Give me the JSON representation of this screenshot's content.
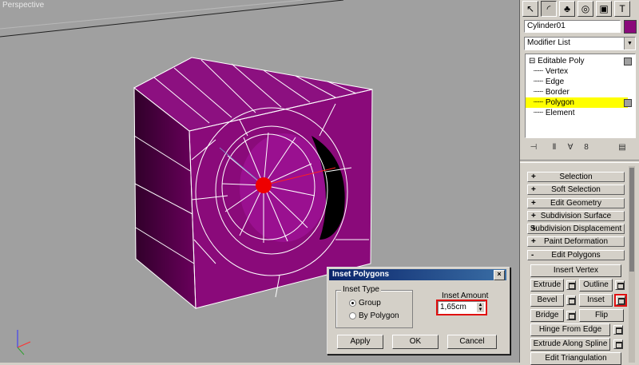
{
  "viewport": {
    "label": "Perspective"
  },
  "panel": {
    "tabs": [
      "pointer-icon",
      "modify-icon",
      "hierarchy-icon",
      "motion-icon",
      "display-icon",
      "utilities-icon"
    ],
    "object_name": "Cylinder01",
    "object_color": "#8a0a7a",
    "modifier_list": "Modifier List",
    "stack": {
      "root": "Editable Poly",
      "items": [
        "Vertex",
        "Edge",
        "Border",
        "Polygon",
        "Element"
      ],
      "selected": "Polygon"
    },
    "rollouts": [
      {
        "sign": "+",
        "label": "Selection"
      },
      {
        "sign": "+",
        "label": "Soft Selection"
      },
      {
        "sign": "+",
        "label": "Edit Geometry"
      },
      {
        "sign": "+",
        "label": "Subdivision Surface"
      },
      {
        "sign": "+",
        "label": "Subdivision Displacement"
      },
      {
        "sign": "+",
        "label": "Paint Deformation"
      },
      {
        "sign": "-",
        "label": "Edit Polygons"
      }
    ],
    "edit_polygons": {
      "insert_vertex": "Insert Vertex",
      "extrude": "Extrude",
      "outline": "Outline",
      "bevel": "Bevel",
      "inset": "Inset",
      "bridge": "Bridge",
      "flip": "Flip",
      "hinge": "Hinge From Edge",
      "extrude_spline": "Extrude Along Spline",
      "edit_triangulation": "Edit Triangulation"
    }
  },
  "dialog": {
    "title": "Inset Polygons",
    "close": "×",
    "inset_type_label": "Inset Type",
    "options": [
      "Group",
      "By Polygon"
    ],
    "selected_option": "Group",
    "amount_label": "Inset Amount",
    "amount_value": "1,65cm",
    "apply": "Apply",
    "ok": "OK",
    "cancel": "Cancel"
  },
  "colors": {
    "accent_highlight": "#e01010",
    "mesh": "#8a0a7a",
    "selection": "#ffff00"
  }
}
